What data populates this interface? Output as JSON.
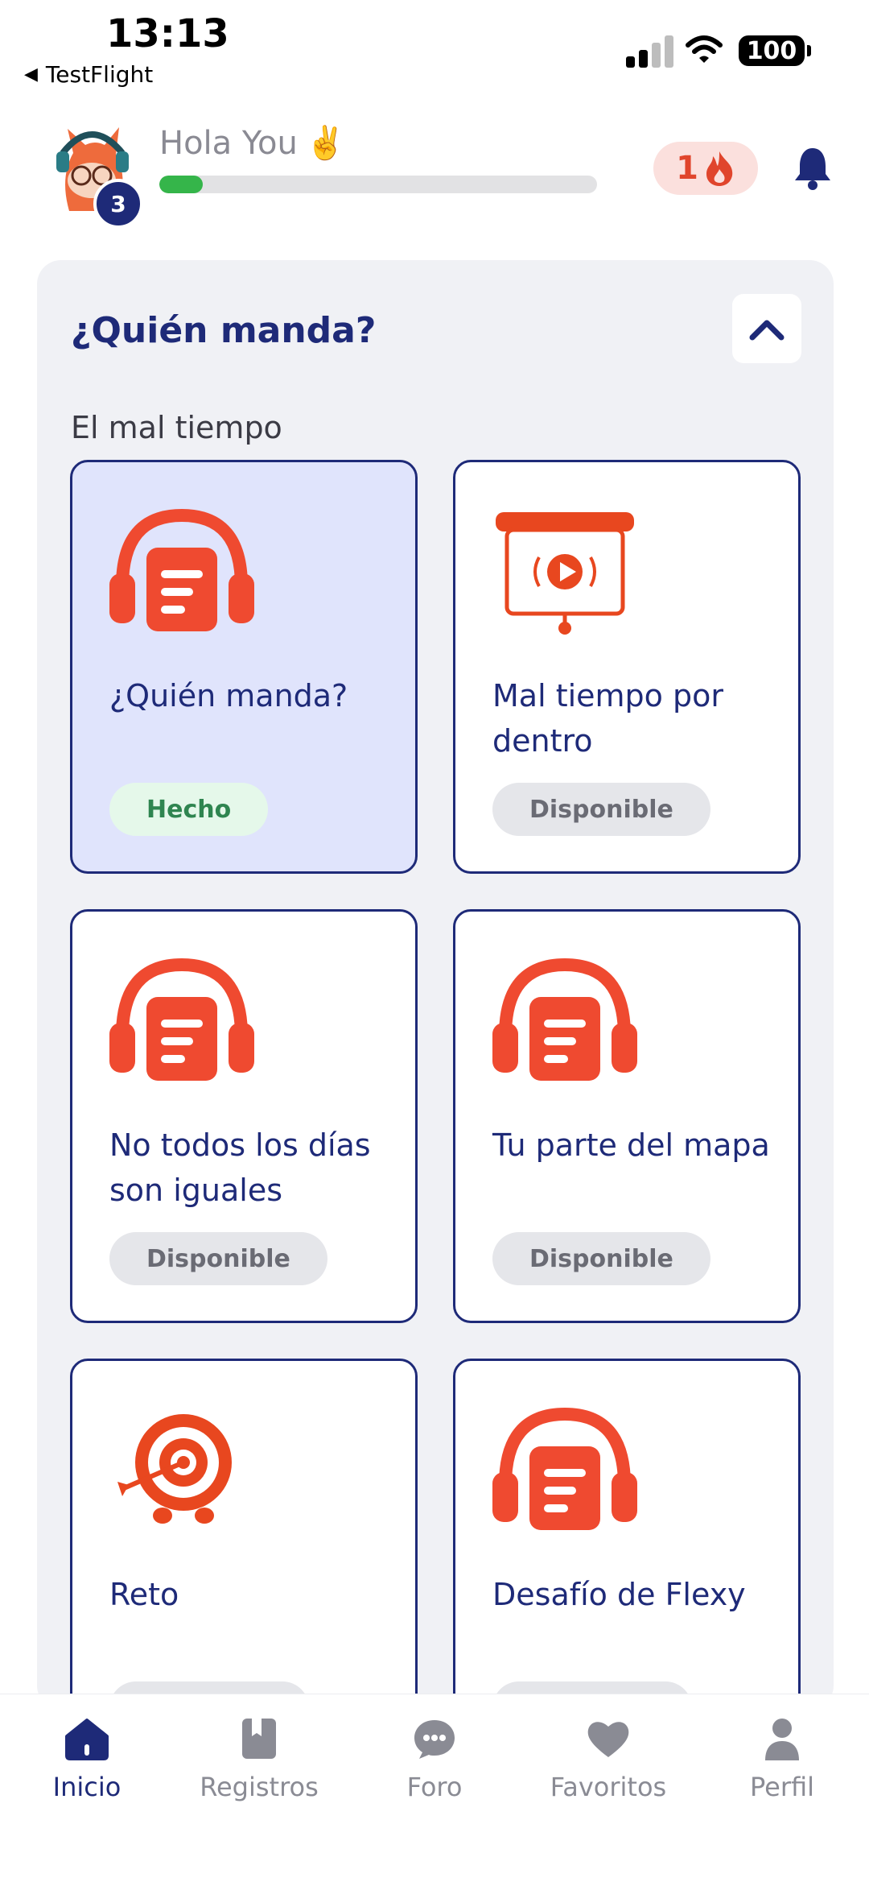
{
  "status_bar": {
    "time": "13:13",
    "back_app": "TestFlight",
    "battery": "100"
  },
  "header": {
    "greeting": "Hola You",
    "greeting_emoji": "✌️",
    "level": "3",
    "xp_progress": 0.1,
    "streak_count": "1",
    "colors": {
      "progress": "#35b54a",
      "streak": "#e0452c"
    }
  },
  "section": {
    "title": "¿Quién manda?",
    "subtitle": "El mal tiempo",
    "cards": [
      {
        "title": "¿Quién manda?",
        "status": "Hecho",
        "icon": "headphones-document-icon",
        "done": true
      },
      {
        "title": "Mal tiempo por dentro",
        "status": "Disponible",
        "icon": "video-presentation-icon",
        "done": false
      },
      {
        "title": "No todos los días son iguales",
        "status": "Disponible",
        "icon": "headphones-document-icon",
        "done": false
      },
      {
        "title": "Tu parte del mapa",
        "status": "Disponible",
        "icon": "headphones-document-icon",
        "done": false
      },
      {
        "title": "Reto",
        "status": "",
        "icon": "target-icon",
        "done": false
      },
      {
        "title": "Desafío de Flexy",
        "status": "",
        "icon": "headphones-document-icon",
        "done": false
      }
    ]
  },
  "nav": {
    "items": [
      {
        "label": "Inicio",
        "icon": "home-icon",
        "active": true
      },
      {
        "label": "Registros",
        "icon": "book-icon",
        "active": false
      },
      {
        "label": "Foro",
        "icon": "chat-icon",
        "active": false
      },
      {
        "label": "Favoritos",
        "icon": "heart-icon",
        "active": false
      },
      {
        "label": "Perfil",
        "icon": "person-icon",
        "active": false
      }
    ]
  },
  "colors": {
    "primary": "#1e2a78",
    "accent": "#ef4a30"
  }
}
